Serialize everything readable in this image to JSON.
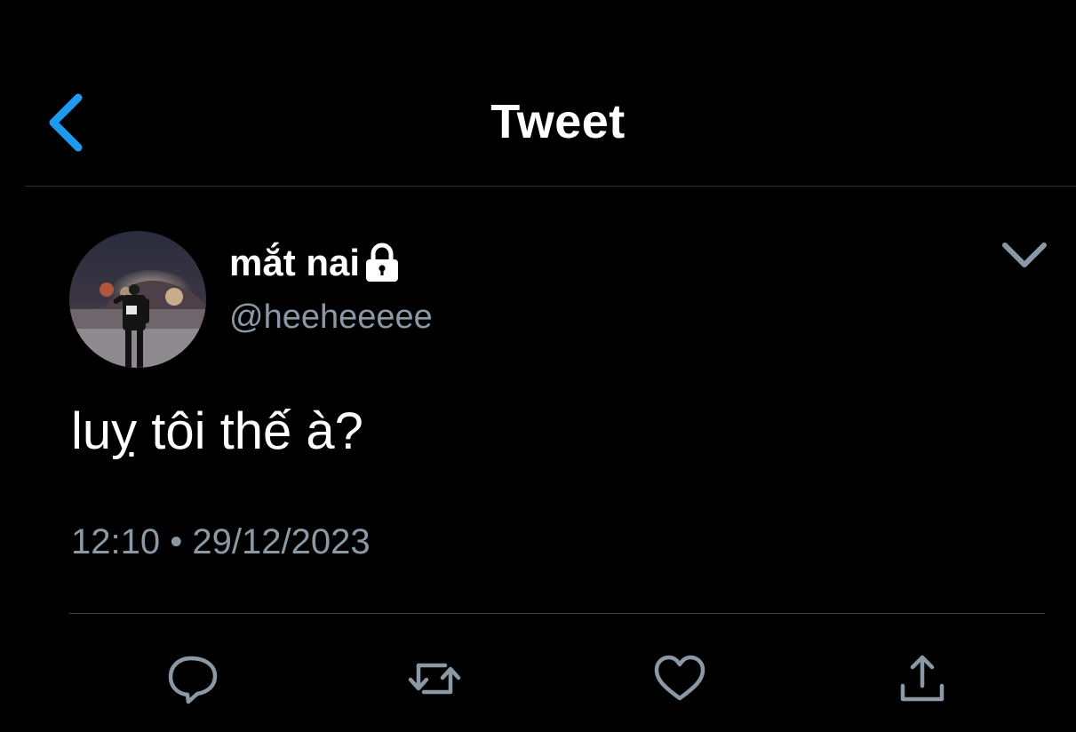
{
  "nav": {
    "title": "Tweet",
    "back_icon": "chevron-left-icon"
  },
  "tweet": {
    "author": {
      "display_name": "mắt nai",
      "handle": "@heeheeeee",
      "protected_icon": "lock-icon",
      "avatar_icon": "avatar-photo"
    },
    "text": "luỵ tôi thế à?",
    "time": "12:10",
    "separator": "•",
    "date": "29/12/2023",
    "menu_icon": "chevron-down-icon"
  },
  "actions": [
    {
      "name": "reply",
      "icon": "speech-bubble-icon"
    },
    {
      "name": "retweet",
      "icon": "retweet-icon"
    },
    {
      "name": "like",
      "icon": "heart-icon"
    },
    {
      "name": "share",
      "icon": "share-icon"
    }
  ],
  "colors": {
    "background": "#000000",
    "accent": "#1d9bf0",
    "primary_text": "#ffffff",
    "secondary_text": "#8b98a5",
    "divider": "#2f3336"
  }
}
